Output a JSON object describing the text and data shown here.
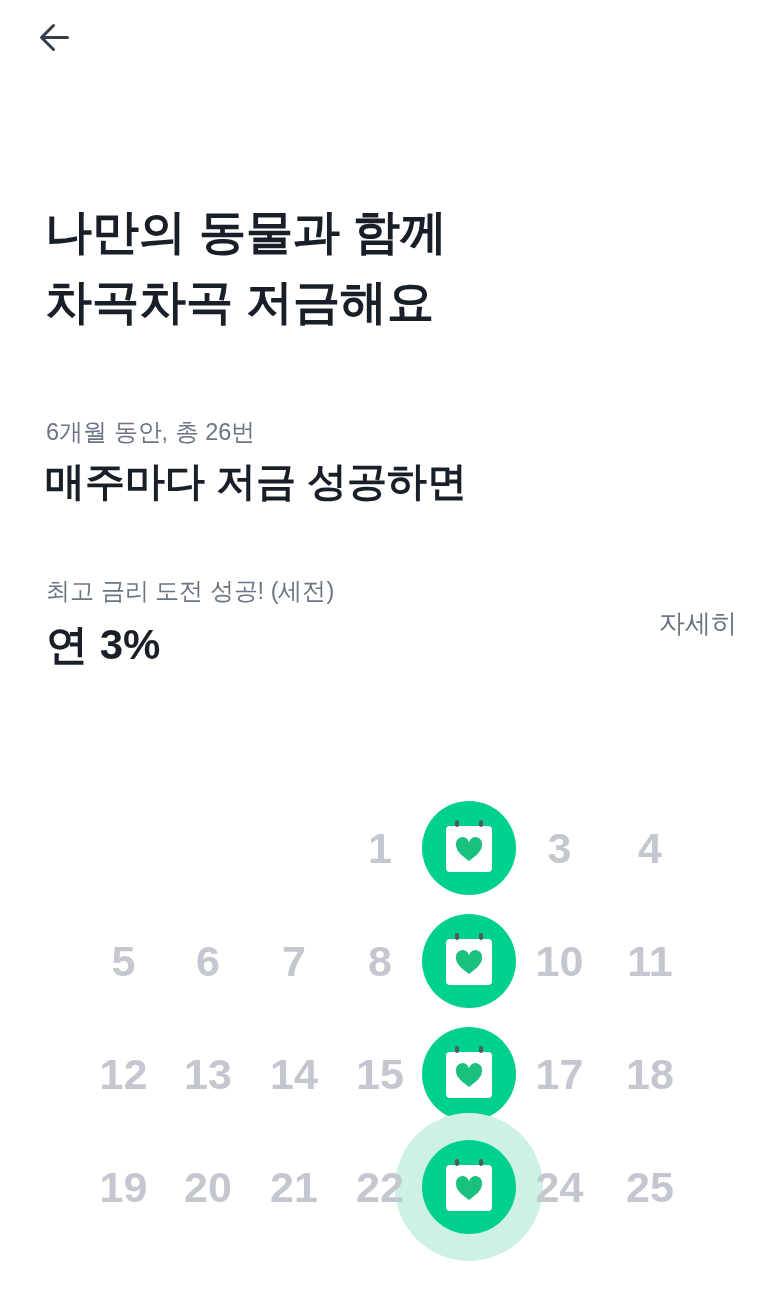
{
  "title": "나만의 동물과 함께\n차곡차곡 저금해요",
  "plan": {
    "caption": "6개월 동안, 총 26번",
    "headline": "매주마다 저금 성공하면"
  },
  "rate": {
    "caption": "최고 금리 도전 성공! (세전)",
    "value": "연 3%",
    "details_link": "자세히"
  },
  "calendar": {
    "weeks": [
      [
        {
          "kind": "blank"
        },
        {
          "kind": "blank"
        },
        {
          "kind": "blank"
        },
        {
          "kind": "day",
          "label": "1"
        },
        {
          "kind": "saved",
          "current": false
        },
        {
          "kind": "day",
          "label": "3"
        },
        {
          "kind": "day",
          "label": "4"
        }
      ],
      [
        {
          "kind": "day",
          "label": "5"
        },
        {
          "kind": "day",
          "label": "6"
        },
        {
          "kind": "day",
          "label": "7"
        },
        {
          "kind": "day",
          "label": "8"
        },
        {
          "kind": "saved",
          "current": false
        },
        {
          "kind": "day",
          "label": "10"
        },
        {
          "kind": "day",
          "label": "11"
        }
      ],
      [
        {
          "kind": "day",
          "label": "12"
        },
        {
          "kind": "day",
          "label": "13"
        },
        {
          "kind": "day",
          "label": "14"
        },
        {
          "kind": "day",
          "label": "15"
        },
        {
          "kind": "saved",
          "current": false
        },
        {
          "kind": "day",
          "label": "17"
        },
        {
          "kind": "day",
          "label": "18"
        }
      ],
      [
        {
          "kind": "day",
          "label": "19"
        },
        {
          "kind": "day",
          "label": "20"
        },
        {
          "kind": "day",
          "label": "21"
        },
        {
          "kind": "day",
          "label": "22"
        },
        {
          "kind": "saved",
          "current": true
        },
        {
          "kind": "day",
          "label": "24"
        },
        {
          "kind": "day",
          "label": "25"
        }
      ]
    ]
  }
}
